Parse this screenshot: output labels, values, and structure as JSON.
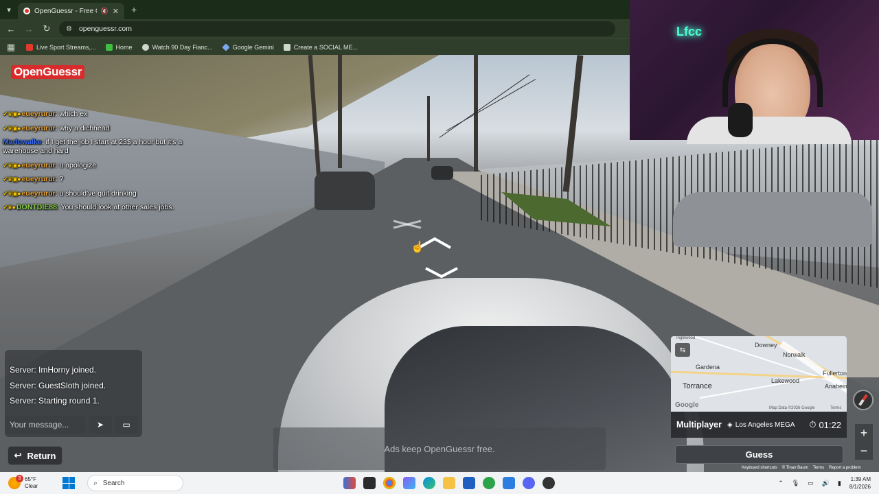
{
  "browser": {
    "tab_title": "OpenGuessr - Free GeoGue",
    "url": "openguessr.com",
    "bookmarks": [
      {
        "label": "Live Sport Streams,...",
        "icon": "live-sport-icon",
        "color": "#e23b2e"
      },
      {
        "label": "Home",
        "icon": "home-k-icon",
        "color": "#3fbf3f"
      },
      {
        "label": "Watch 90 Day Fianc...",
        "icon": "watch-icon",
        "color": "#cfd6cc"
      },
      {
        "label": "Google Gemini",
        "icon": "gemini-icon",
        "color": "#7aa7f0"
      },
      {
        "label": "Create a SOCIAL ME...",
        "icon": "doc-icon",
        "color": "#cfd6cc"
      }
    ]
  },
  "game": {
    "logo": "OpenGuessr",
    "server_messages": [
      "Server: ImHorny joined.",
      "Server: GuestSloth joined.",
      "Server: Starting round 1."
    ],
    "message_placeholder": "Your message...",
    "return_label": "Return",
    "ad_text": "Ads keep OpenGuessr free.",
    "mode": "Multiplayer",
    "map_name": "Los Angeles MEGA",
    "timer": "01:22",
    "guess_label": "Guess",
    "map_labels": {
      "downey": "Downey",
      "norwalk": "Norwalk",
      "gardena": "Gardena",
      "lakewood": "Lakewood",
      "fullerton": "Fullerton",
      "torrance": "Torrance",
      "anaheim": "Anaheim",
      "inglewood": "Inglewood",
      "google": "Google",
      "map_data": "Map Data ©2026 Google",
      "terms": "Terms"
    },
    "footer_links": [
      "Keyboard shortcuts",
      "© Tinan Baum",
      "Terms",
      "Report a problem"
    ]
  },
  "twitch_chat": [
    {
      "user": "eueyrurur",
      "text": "which ex"
    },
    {
      "user": "eueyrurur",
      "text": "why a dichhead"
    },
    {
      "user": "Marlowalke",
      "text": "if I get the job I start at 23$ a hour but it's a warehouse and hard"
    },
    {
      "user": "eueyrurur",
      "text": "u apologize"
    },
    {
      "user": "eueyrurur",
      "text": "?"
    },
    {
      "user": "eueyrurur",
      "text": "u should've quit drinking"
    },
    {
      "user": "DONTDIE88",
      "text": "You should look at other sales jobs."
    }
  ],
  "webcam": {
    "neon_sign": "Lfcc"
  },
  "taskbar": {
    "weather_temp": "65°F",
    "weather_desc": "Clear",
    "weather_badge": "3",
    "search_label": "Search",
    "time": "1:39 AM",
    "date": "8/1/2026"
  }
}
